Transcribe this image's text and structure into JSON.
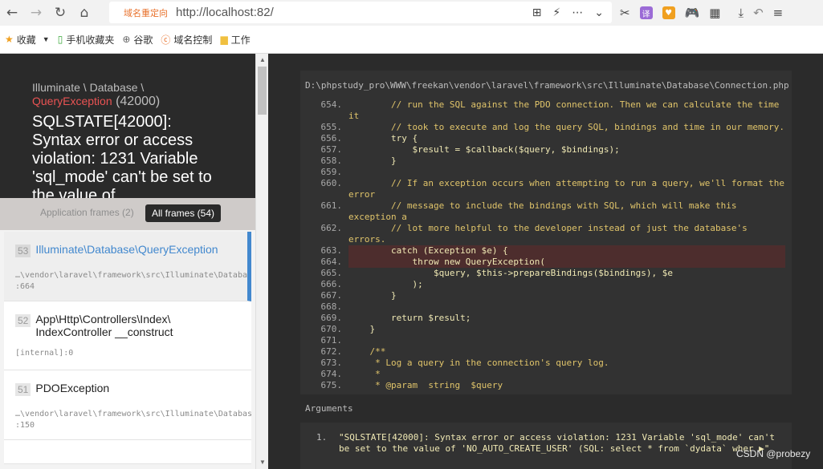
{
  "browser": {
    "url_tag": "域名重定向",
    "url": "http://localhost:82/",
    "bookmarks": [
      {
        "label": "收藏",
        "icon": "star-icon"
      },
      {
        "label": "手机收藏夹",
        "icon": "phone-icon"
      },
      {
        "label": "谷歌",
        "icon": "globe-icon"
      },
      {
        "label": "域名控制",
        "icon": "domain-icon"
      },
      {
        "label": "工作",
        "icon": "folder-icon"
      }
    ]
  },
  "exception": {
    "namespace": "Illuminate \\ Database \\",
    "class": "QueryException",
    "code": "(42000)",
    "message": "SQLSTATE[42000]: Syntax error or access violation: 1231 Variable 'sql_mode' can't be set to the value of"
  },
  "tabs": {
    "application": "Application frames (2)",
    "all": "All frames (54)"
  },
  "frames": [
    {
      "index": "53",
      "class": "Illuminate\\Database\\QueryException",
      "path": "…\\vendor\\laravel\\framework\\src\\Illuminate\\Database\\Connection.php",
      "line": ":664",
      "active": true
    },
    {
      "index": "52",
      "class": "App\\Http\\Controllers\\Index\\ IndexController __construct",
      "path": "[internal]:0",
      "line": "",
      "active": false
    },
    {
      "index": "51",
      "class": "PDOException",
      "path": "…\\vendor\\laravel\\framework\\src\\Illuminate\\Database\\Connection.php",
      "line": ":150",
      "active": false
    }
  ],
  "code": {
    "file_path": "D:\\phpstudy_pro\\WWW\\freekan\\vendor\\laravel\\framework\\src\\Illuminate\\Database\\Connection.php",
    "lines": [
      {
        "n": "654.",
        "t": "        // run the SQL against the PDO connection. Then we can calculate the time it",
        "cls": "c"
      },
      {
        "n": "655.",
        "t": "        // took to execute and log the query SQL, bindings and time in our memory.",
        "cls": "c"
      },
      {
        "n": "656.",
        "t": "        try {",
        "cls": "v"
      },
      {
        "n": "657.",
        "t": "            $result = $callback($query, $bindings);",
        "cls": "v"
      },
      {
        "n": "658.",
        "t": "        }",
        "cls": "v"
      },
      {
        "n": "659.",
        "t": "",
        "cls": "v"
      },
      {
        "n": "660.",
        "t": "        // If an exception occurs when attempting to run a query, we'll format the error",
        "cls": "c"
      },
      {
        "n": "661.",
        "t": "        // message to include the bindings with SQL, which will make this exception a",
        "cls": "c"
      },
      {
        "n": "662.",
        "t": "        // lot more helpful to the developer instead of just the database's errors.",
        "cls": "c"
      },
      {
        "n": "663.",
        "t": "        catch (Exception $e) {",
        "cls": "v",
        "hl": true
      },
      {
        "n": "664.",
        "t": "            throw new QueryException(",
        "cls": "v",
        "hl": true
      },
      {
        "n": "665.",
        "t": "                $query, $this->prepareBindings($bindings), $e",
        "cls": "v"
      },
      {
        "n": "666.",
        "t": "            );",
        "cls": "v"
      },
      {
        "n": "667.",
        "t": "        }",
        "cls": "v"
      },
      {
        "n": "668.",
        "t": "",
        "cls": "v"
      },
      {
        "n": "669.",
        "t": "        return $result;",
        "cls": "v"
      },
      {
        "n": "670.",
        "t": "    }",
        "cls": "v"
      },
      {
        "n": "671.",
        "t": "",
        "cls": "v"
      },
      {
        "n": "672.",
        "t": "    /**",
        "cls": "c"
      },
      {
        "n": "673.",
        "t": "     * Log a query in the connection's query log.",
        "cls": "c"
      },
      {
        "n": "674.",
        "t": "     *",
        "cls": "c"
      },
      {
        "n": "675.",
        "t": "     * @param  string  $query",
        "cls": "c"
      }
    ]
  },
  "arguments": {
    "label": "Arguments",
    "items": [
      {
        "num": "1.",
        "text": "\"SQLSTATE[42000]: Syntax error or access violation: 1231 Variable 'sql_mode' can't be set to the value of 'NO_AUTO_CREATE_USER' (SQL: select * from `dydata` wher ▶\""
      }
    ]
  },
  "watermark": "CSDN @probezy",
  "colors": {
    "accent": "#4288ce",
    "error": "#e95353",
    "highlight": "#4d2d2d"
  }
}
